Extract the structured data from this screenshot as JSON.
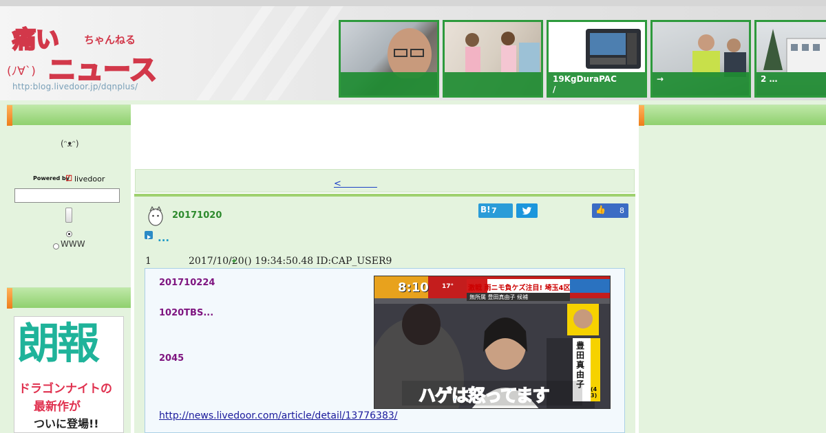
{
  "header": {
    "logo_text_main": "痛いニュース",
    "logo_text_sub": "ちゃんねる",
    "logo_face": "(ﾉ∀`)",
    "logo_url": "http:blog.livedoor.jp/dqnplus/",
    "thumbs": [
      {
        "caption": ""
      },
      {
        "caption": ""
      },
      {
        "caption": "19KgDuraPAC\n/"
      },
      {
        "caption": "→"
      },
      {
        "caption": "2 …"
      }
    ]
  },
  "sidebar": {
    "face_emoticon": "(ᵔᴥᵔ)",
    "powered_by": "Powered by",
    "livedoor": "livedoor",
    "radio_www": "WWW",
    "banner": {
      "title": "朗報",
      "line1": "ドラゴンナイトの",
      "line2": "最新作が",
      "line3": "ついに登場!!"
    }
  },
  "nav": {
    "prev_link": "<　　　　"
  },
  "article": {
    "date": "20171020",
    "title": "...",
    "hatena_count": "7",
    "like_count": "8",
    "post_number": "1",
    "post_meta": "2017/10/20() 19:34:50.48 ID:CAP_USER9",
    "quote_lines": [
      "201710224",
      "1020TBS...",
      "2045"
    ],
    "news_url": "http://news.livedoor.com/article/detail/13776383/",
    "tv": {
      "time": "8:10",
      "temp": "17°",
      "headline": "激戦 雨ニモ負ケズ注目! 埼玉4区",
      "candidate": "無所属 豊田真由子 候補",
      "caption": "ハゲは怒ってます",
      "name_vertical": "豊田真由子",
      "age": "(43)",
      "party": "無所属"
    }
  },
  "colors": {
    "accent_green": "#2d9a3c",
    "link_blue": "#1a3fc6",
    "quote_purple": "#7e1580"
  }
}
